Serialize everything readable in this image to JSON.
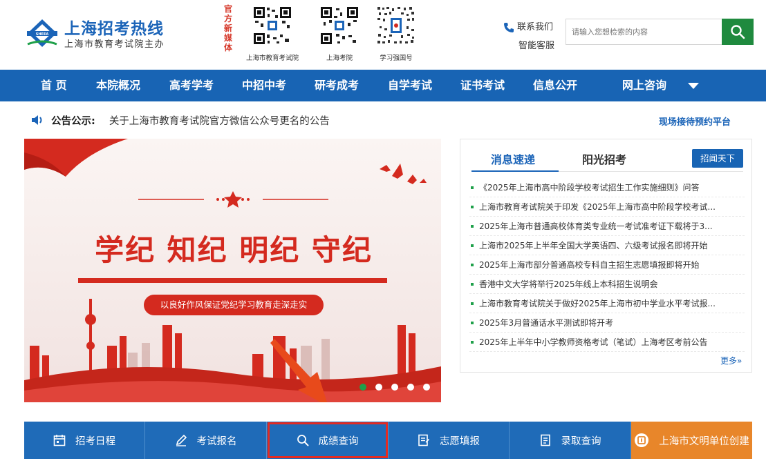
{
  "header": {
    "site_title": "上海招考热线",
    "site_subtitle": "上海市教育考试院主办",
    "media_label": "官方新媒体",
    "qr_codes": [
      {
        "caption": "上海市教育考试院"
      },
      {
        "caption": "上海考院"
      },
      {
        "caption": "学习强国号"
      }
    ],
    "contact_label": "联系我们",
    "service_label": "智能客服",
    "search": {
      "placeholder": "请输入您想检索的内容",
      "value": ""
    }
  },
  "nav": {
    "items": [
      "首 页",
      "本院概况",
      "高考学考",
      "中招中考",
      "研考成考",
      "自学考试",
      "证书考试",
      "信息公开",
      "网上咨询"
    ]
  },
  "notice": {
    "label": "公告公示:",
    "text": "关于上海市教育考试院官方微信公众号更名的公告",
    "appointment_link": "现场接待预约平台"
  },
  "banner": {
    "headline": "学纪 知纪 明纪 守纪",
    "slogan": "以良好作风保证党纪学习教育走深走实",
    "slide_count": 5,
    "active_slide": 1
  },
  "news": {
    "tabs": [
      "消息速递",
      "阳光招考"
    ],
    "active_tab": 0,
    "badge": "招闻天下",
    "items": [
      "《2025年上海市高中阶段学校考试招生工作实施细则》问答",
      "上海市教育考试院关于印发《2025年上海市高中阶段学校考试...",
      "2025年上海市普通高校体育类专业统一考试准考证下载将于3...",
      "上海市2025年上半年全国大学英语四、六级考试报名即将开始",
      "2025年上海市部分普通高校专科自主招生志愿填报即将开始",
      "香港中文大学将举行2025年线上本科招生说明会",
      "上海市教育考试院关于做好2025年上海市初中学业水平考试报...",
      "2025年3月普通话水平测试即将开考",
      "2025年上半年中小学教师资格考试（笔试）上海考区考前公告"
    ],
    "more": "更多»"
  },
  "tiles": [
    {
      "label": "招考日程",
      "icon": "calendar-icon"
    },
    {
      "label": "考试报名",
      "icon": "pencil-icon"
    },
    {
      "label": "成绩查询",
      "icon": "search-icon",
      "highlighted": true
    },
    {
      "label": "志愿填报",
      "icon": "form-icon"
    },
    {
      "label": "录取查询",
      "icon": "document-icon"
    },
    {
      "label": "上海市文明单位创建",
      "icon": "civilization-icon"
    }
  ],
  "colors": {
    "brand_blue": "#1864b4",
    "search_green": "#1f8a3e",
    "banner_red": "#d42a1f",
    "tile_blue": "#1f6bb8",
    "tile_orange": "#e8862a",
    "highlight_red": "#e32b22"
  }
}
